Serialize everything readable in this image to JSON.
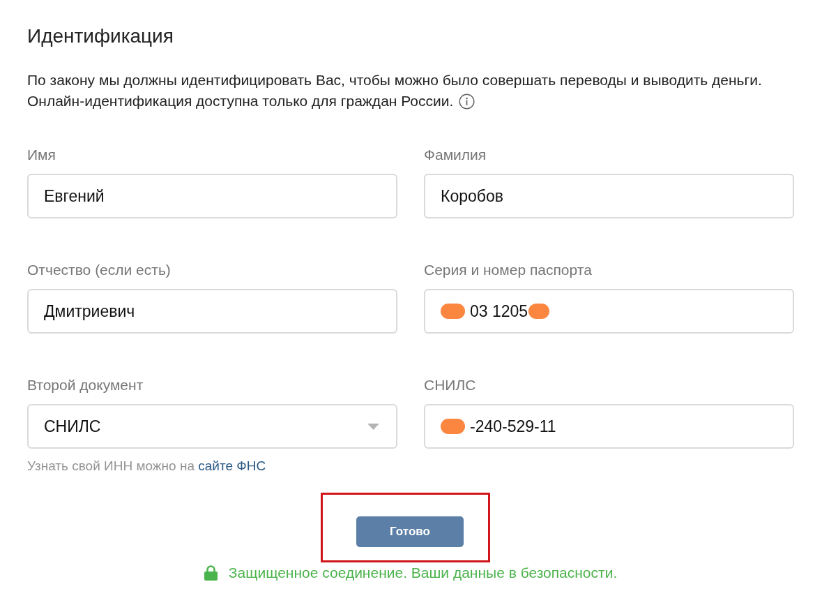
{
  "title": "Идентификация",
  "description": [
    "По закону мы должны идентифицировать Вас, чтобы можно было совершать переводы и выводить деньги.",
    "Онлайн-идентификация доступна только для граждан России."
  ],
  "fields": [
    {
      "kind": "text",
      "label": "Имя",
      "value": "Евгений"
    },
    {
      "kind": "text",
      "label": "Фамилия",
      "value": "Коробов"
    },
    {
      "kind": "text",
      "label": "Отчество (если есть)",
      "value": "Дмитриевич"
    },
    {
      "kind": "text",
      "label": "Серия и номер паспорта",
      "value": "03 1205",
      "redacted_start": true,
      "redacted_end": true
    },
    {
      "kind": "select",
      "label": "Второй документ",
      "value": "СНИЛС"
    },
    {
      "kind": "text",
      "label": "СНИЛС",
      "value": "-240-529-11",
      "redacted_start": true
    }
  ],
  "hint": {
    "text": "Узнать свой ИНН можно на",
    "link": "сайте ФНС"
  },
  "submit_button": {
    "label": "Готово",
    "highlighted": true
  },
  "security_note": "Защищенное соединение. Ваши данные в безопасности."
}
